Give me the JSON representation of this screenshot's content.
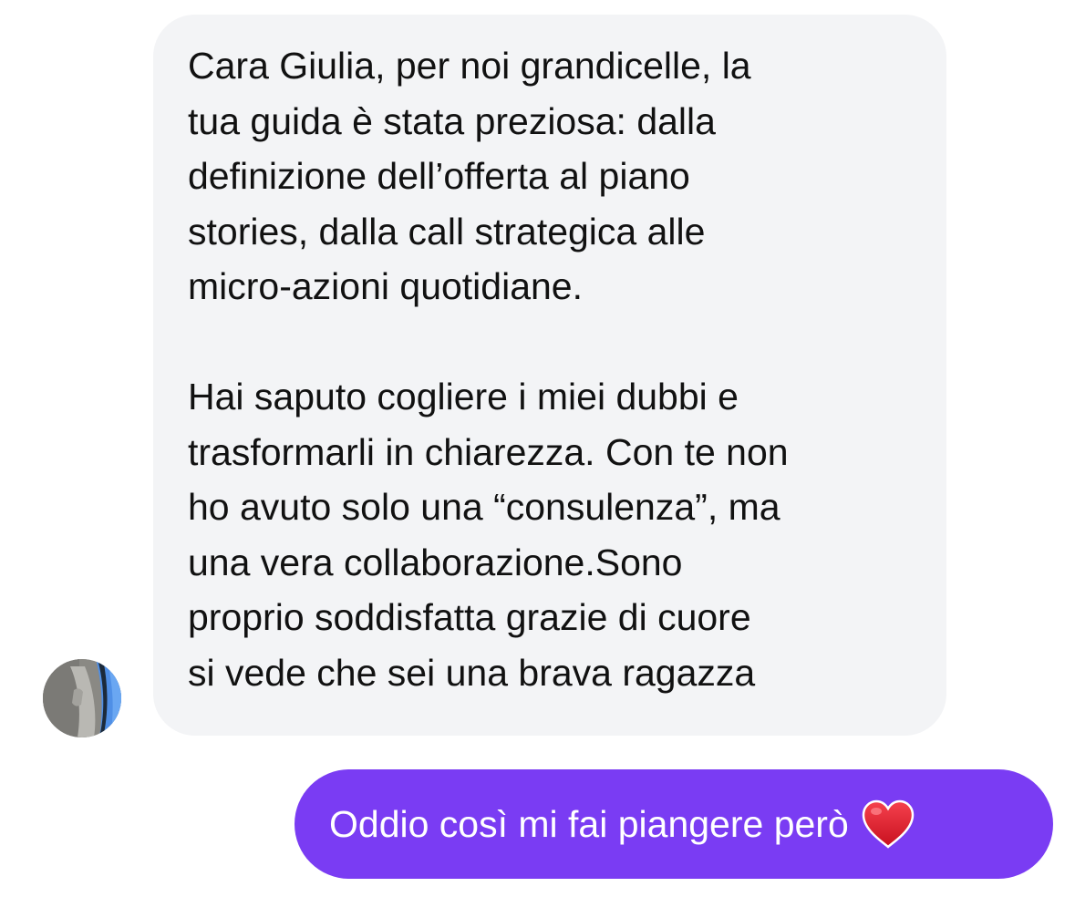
{
  "conversation": {
    "incoming": {
      "paragraphs": [
        "Cara Giulia, per noi grandicelle, la\ntua guida è stata preziosa: dalla\ndefinizione dell’offerta al piano\nstories, dalla call strategica alle\nmicro-azioni quotidiane.",
        "Hai saputo cogliere i miei dubbi e\ntrasformarli in chiarezza. Con te non\nho avuto solo una “consulenza”, ma\nuna vera collaborazione.Sono\nproprio soddisfatta grazie di cuore\nsi vede che sei una brava ragazza"
      ]
    },
    "outgoing": {
      "text": "Oddio così mi fai piangere però",
      "emoji": "heart-icon"
    }
  },
  "colors": {
    "incoming_bubble": "#f3f4f6",
    "outgoing_bubble": "#7a3cf3",
    "incoming_text": "#111111",
    "outgoing_text": "#ffffff",
    "heart": "#e0202e"
  }
}
